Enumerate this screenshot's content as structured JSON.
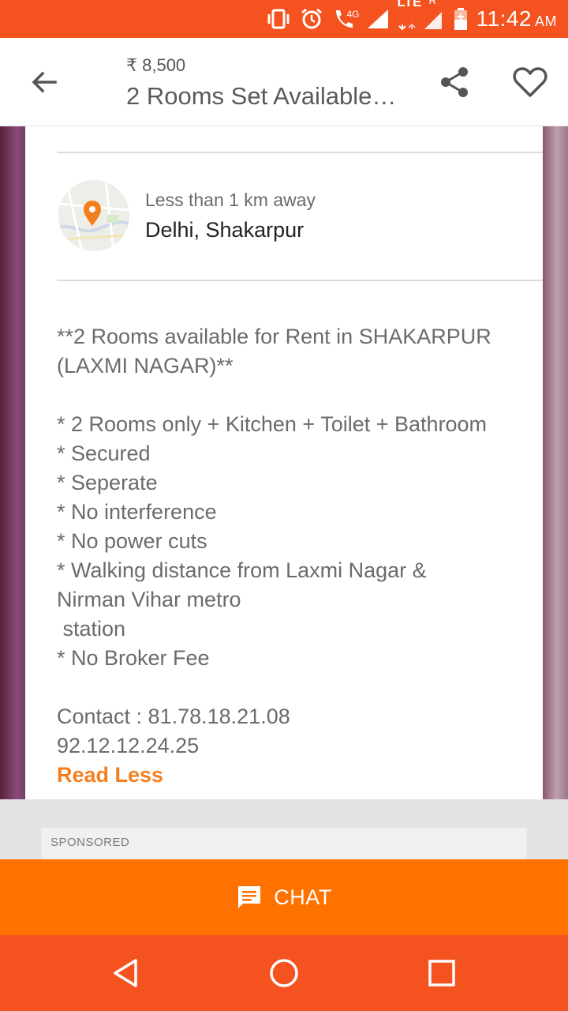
{
  "status_bar": {
    "network_label": "4G",
    "lte_label": "LTE",
    "roaming_label": "R",
    "time": "11:42",
    "am_pm": "AM"
  },
  "app_bar": {
    "price": "₹ 8,500",
    "title": "2 Rooms Set Available…"
  },
  "location": {
    "distance": "Less than 1 km away",
    "place": "Delhi, Shakarpur"
  },
  "description": {
    "heading_lines": [
      "**2 Rooms available for Rent in SHAKARPUR",
      "(LAXMI NAGAR)**"
    ],
    "bullets": [
      "* 2 Rooms only + Kitchen + Toilet + Bathroom",
      "* Secured",
      "* Seperate",
      "* No interference",
      "* No power cuts",
      "* Walking distance from Laxmi Nagar &",
      "Nirman Vihar metro",
      " station",
      "* No Broker Fee"
    ],
    "contact_lines": [
      "Contact : 81.78.18.21.08",
      "92.12.12.24.25"
    ],
    "read_less": "Read Less"
  },
  "sponsored": {
    "label": "SPONSORED"
  },
  "chat": {
    "label": "CHAT"
  },
  "colors": {
    "status_bar": "#f4521e",
    "accent": "#ff7200",
    "link": "#f47f1f"
  },
  "icons": {
    "back": "arrow-back-icon",
    "share": "share-icon",
    "favorite": "heart-icon",
    "chat": "chat-bubble-icon",
    "nav_back": "triangle-back-icon",
    "nav_home": "circle-home-icon",
    "nav_recents": "square-recents-icon"
  }
}
